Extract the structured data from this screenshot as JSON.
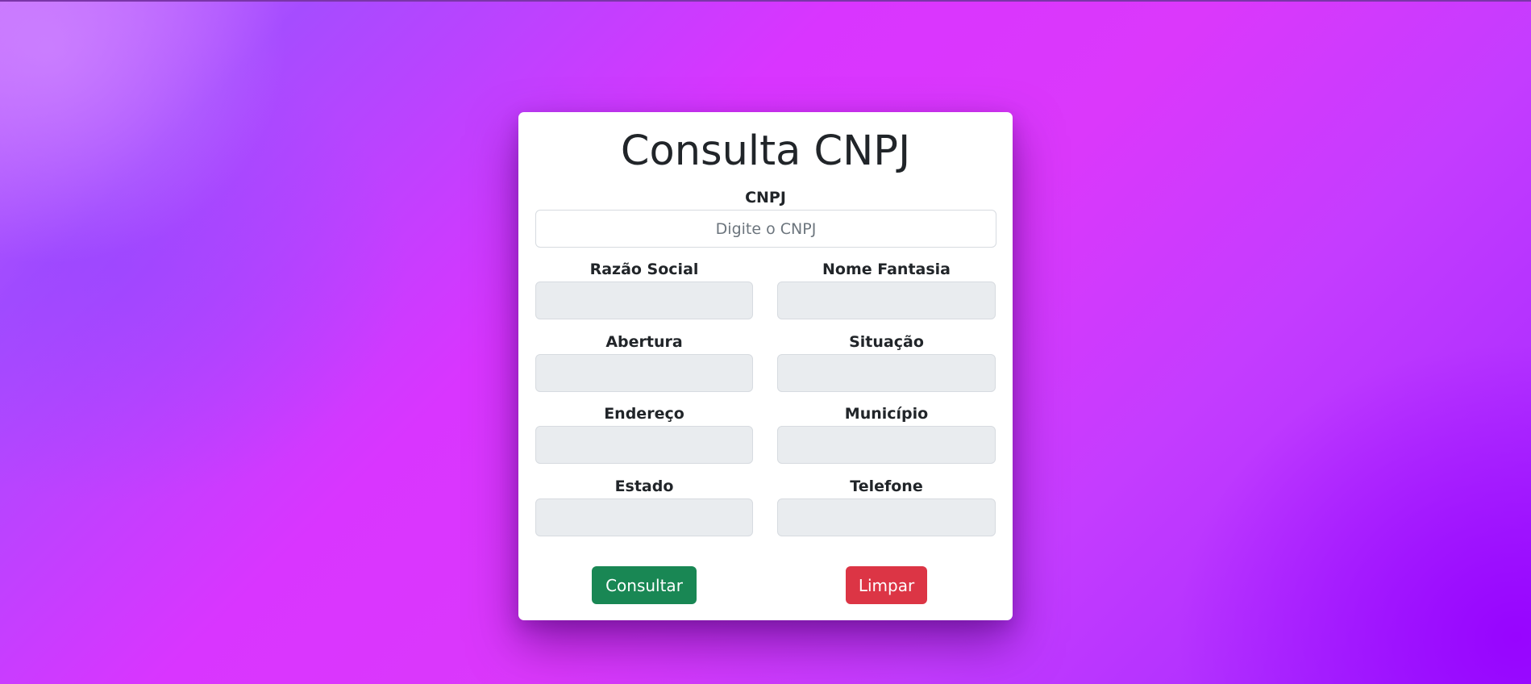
{
  "page": {
    "title": "Consulta CNPJ"
  },
  "form": {
    "cnpj": {
      "label": "CNPJ",
      "placeholder": "Digite o CNPJ",
      "value": ""
    },
    "razao_social": {
      "label": "Razão Social",
      "value": ""
    },
    "nome_fantasia": {
      "label": "Nome Fantasia",
      "value": ""
    },
    "abertura": {
      "label": "Abertura",
      "value": ""
    },
    "situacao": {
      "label": "Situação",
      "value": ""
    },
    "endereco": {
      "label": "Endereço",
      "value": ""
    },
    "municipio": {
      "label": "Município",
      "value": ""
    },
    "estado": {
      "label": "Estado",
      "value": ""
    },
    "telefone": {
      "label": "Telefone",
      "value": ""
    }
  },
  "actions": {
    "consultar_label": "Consultar",
    "limpar_label": "Limpar"
  },
  "colors": {
    "card_background": "#ffffff",
    "readonly_field": "#e9ecef",
    "consultar_button": "#198754",
    "limpar_button": "#dc3545",
    "text": "#212529"
  }
}
